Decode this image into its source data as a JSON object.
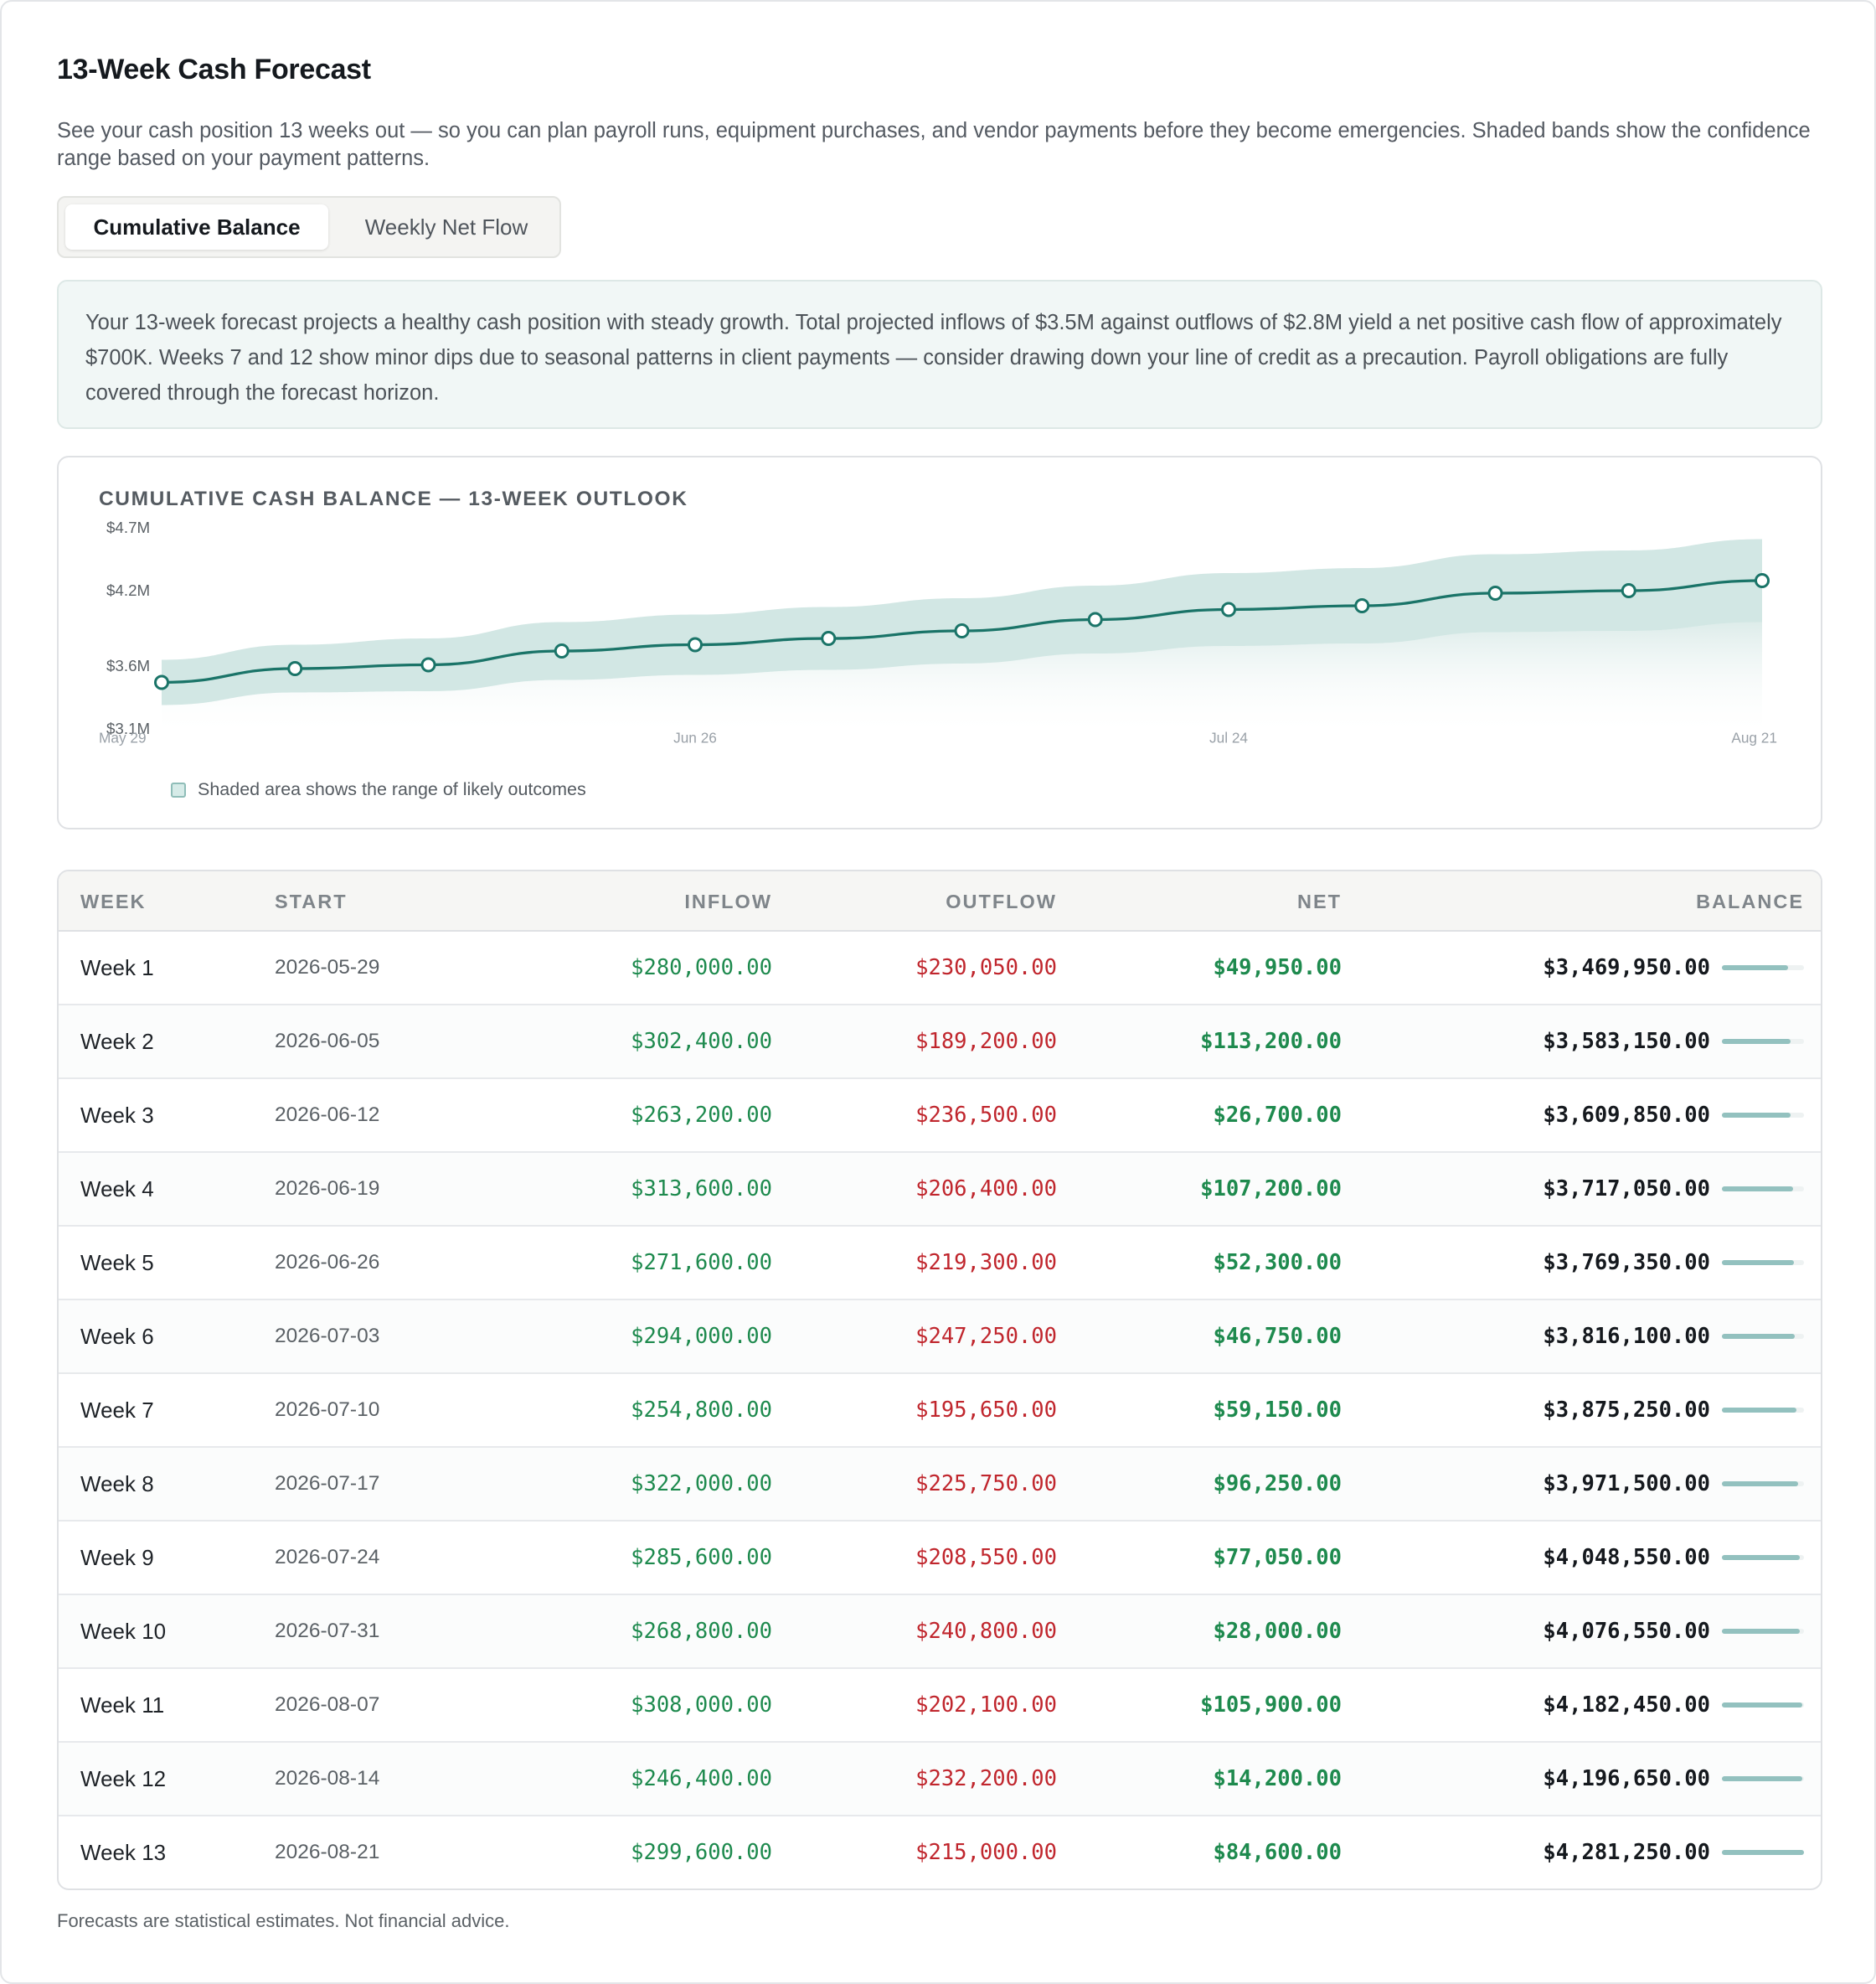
{
  "page": {
    "title": "13-Week Cash Forecast",
    "subtitle": "See your cash position 13 weeks out — so you can plan payroll runs, equipment purchases, and vendor payments before they become emergencies. Shaded bands show the confidence range based on your payment patterns.",
    "footer": "Forecasts are statistical estimates. Not financial advice."
  },
  "tabs": [
    {
      "label": "Cumulative Balance",
      "active": true
    },
    {
      "label": "Weekly Net Flow",
      "active": false
    }
  ],
  "summary": {
    "text": "Your 13-week forecast projects a healthy cash position with steady growth. Total projected inflows of $3.5M against outflows of $2.8M yield a net positive cash flow of approximately $700K. Weeks 7 and 12 show minor dips due to seasonal patterns in client payments — consider drawing down your line of credit as a precaution. Payroll obligations are fully covered through the forecast horizon."
  },
  "chart": {
    "heading": "CUMULATIVE CASH BALANCE — 13-WEEK OUTLOOK",
    "legend": "Shaded area shows the range of likely outcomes",
    "colors": {
      "line": "#1a7468",
      "band": "#9ccac4",
      "point_fill": "#ffffff"
    }
  },
  "chart_data": {
    "type": "line",
    "title": "CUMULATIVE CASH BALANCE — 13-WEEK OUTLOOK",
    "x_tick_labels": [
      "May 29",
      "Jun 26",
      "Jul 24",
      "Aug 21"
    ],
    "y_tick_labels": [
      "$4.7M",
      "$4.2M",
      "$3.6M",
      "$3.1M"
    ],
    "ylim": [
      3.1,
      4.7
    ],
    "y_unit": "$M",
    "x": [
      "2026-05-29",
      "2026-06-05",
      "2026-06-12",
      "2026-06-19",
      "2026-06-26",
      "2026-07-03",
      "2026-07-10",
      "2026-07-17",
      "2026-07-24",
      "2026-07-31",
      "2026-08-07",
      "2026-08-14",
      "2026-08-21"
    ],
    "series": [
      {
        "values": [
          3.47,
          3.58,
          3.61,
          3.72,
          3.77,
          3.82,
          3.88,
          3.97,
          4.05,
          4.08,
          4.18,
          4.2,
          4.28
        ]
      }
    ],
    "band": {
      "lower": [
        3.29,
        3.39,
        3.4,
        3.49,
        3.53,
        3.57,
        3.62,
        3.7,
        3.76,
        3.78,
        3.87,
        3.88,
        3.95
      ],
      "upper": [
        3.65,
        3.77,
        3.82,
        3.95,
        4.01,
        4.07,
        4.14,
        4.24,
        4.34,
        4.38,
        4.49,
        4.52,
        4.61
      ]
    },
    "grid": false
  },
  "table": {
    "columns": [
      "WEEK",
      "START",
      "INFLOW",
      "OUTFLOW",
      "NET",
      "BALANCE"
    ],
    "rows": [
      {
        "week": "Week 1",
        "start": "2026-05-29",
        "inflow": "$280,000.00",
        "outflow": "$230,050.00",
        "net": "$49,950.00",
        "balance": "$3,469,950.00",
        "balance_fraction": 0.81
      },
      {
        "week": "Week 2",
        "start": "2026-06-05",
        "inflow": "$302,400.00",
        "outflow": "$189,200.00",
        "net": "$113,200.00",
        "balance": "$3,583,150.00",
        "balance_fraction": 0.84
      },
      {
        "week": "Week 3",
        "start": "2026-06-12",
        "inflow": "$263,200.00",
        "outflow": "$236,500.00",
        "net": "$26,700.00",
        "balance": "$3,609,850.00",
        "balance_fraction": 0.84
      },
      {
        "week": "Week 4",
        "start": "2026-06-19",
        "inflow": "$313,600.00",
        "outflow": "$206,400.00",
        "net": "$107,200.00",
        "balance": "$3,717,050.00",
        "balance_fraction": 0.87
      },
      {
        "week": "Week 5",
        "start": "2026-06-26",
        "inflow": "$271,600.00",
        "outflow": "$219,300.00",
        "net": "$52,300.00",
        "balance": "$3,769,350.00",
        "balance_fraction": 0.88
      },
      {
        "week": "Week 6",
        "start": "2026-07-03",
        "inflow": "$294,000.00",
        "outflow": "$247,250.00",
        "net": "$46,750.00",
        "balance": "$3,816,100.00",
        "balance_fraction": 0.89
      },
      {
        "week": "Week 7",
        "start": "2026-07-10",
        "inflow": "$254,800.00",
        "outflow": "$195,650.00",
        "net": "$59,150.00",
        "balance": "$3,875,250.00",
        "balance_fraction": 0.91
      },
      {
        "week": "Week 8",
        "start": "2026-07-17",
        "inflow": "$322,000.00",
        "outflow": "$225,750.00",
        "net": "$96,250.00",
        "balance": "$3,971,500.00",
        "balance_fraction": 0.93
      },
      {
        "week": "Week 9",
        "start": "2026-07-24",
        "inflow": "$285,600.00",
        "outflow": "$208,550.00",
        "net": "$77,050.00",
        "balance": "$4,048,550.00",
        "balance_fraction": 0.95
      },
      {
        "week": "Week 10",
        "start": "2026-07-31",
        "inflow": "$268,800.00",
        "outflow": "$240,800.00",
        "net": "$28,000.00",
        "balance": "$4,076,550.00",
        "balance_fraction": 0.95
      },
      {
        "week": "Week 11",
        "start": "2026-08-07",
        "inflow": "$308,000.00",
        "outflow": "$202,100.00",
        "net": "$105,900.00",
        "balance": "$4,182,450.00",
        "balance_fraction": 0.98
      },
      {
        "week": "Week 12",
        "start": "2026-08-14",
        "inflow": "$246,400.00",
        "outflow": "$232,200.00",
        "net": "$14,200.00",
        "balance": "$4,196,650.00",
        "balance_fraction": 0.98
      },
      {
        "week": "Week 13",
        "start": "2026-08-21",
        "inflow": "$299,600.00",
        "outflow": "$215,000.00",
        "net": "$84,600.00",
        "balance": "$4,281,250.00",
        "balance_fraction": 1.0
      }
    ]
  }
}
